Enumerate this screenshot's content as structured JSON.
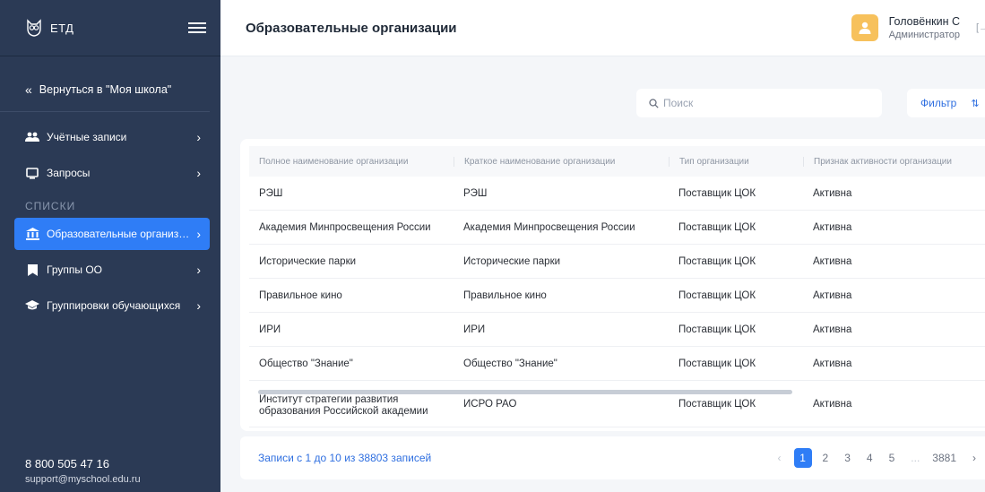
{
  "app": {
    "logo_text": "ЕТД"
  },
  "sidebar": {
    "back_label": "Вернуться в \"Моя школа\"",
    "items": [
      {
        "label": "Учётные записи",
        "icon": "users-icon"
      },
      {
        "label": "Запросы",
        "icon": "monitor-icon"
      }
    ],
    "section_label": "СПИСКИ",
    "list_items": [
      {
        "label": "Образовательные организа...",
        "icon": "bank-icon",
        "active": true
      },
      {
        "label": "Группы ОО",
        "icon": "bookmark-icon"
      },
      {
        "label": "Группировки обучающихся",
        "icon": "graduation-cap-icon"
      }
    ],
    "phone": "8 800 505 47 16",
    "email": "support@myschool.edu.ru"
  },
  "header": {
    "title": "Образовательные организации",
    "user_name": "Головёнкин С",
    "user_role": "Администратор",
    "logout_label": "[→"
  },
  "toolbar": {
    "search_placeholder": "Поиск",
    "filter_label": "Фильтр"
  },
  "table": {
    "columns": [
      "Полное наименование организации",
      "Краткое наименование организации",
      "Тип организации",
      "Признак активности организации"
    ],
    "rows": [
      [
        "РЭШ",
        "РЭШ",
        "Поставщик ЦОК",
        "Активна"
      ],
      [
        "Академия Минпросвещения России",
        "Академия Минпросвещения России",
        "Поставщик ЦОК",
        "Активна"
      ],
      [
        "Исторические парки",
        "Исторические парки",
        "Поставщик ЦОК",
        "Активна"
      ],
      [
        "Правильное кино",
        "Правильное кино",
        "Поставщик ЦОК",
        "Активна"
      ],
      [
        "ИРИ",
        "ИРИ",
        "Поставщик ЦОК",
        "Активна"
      ],
      [
        "Общество \"Знание\"",
        "Общество \"Знание\"",
        "Поставщик ЦОК",
        "Активна"
      ],
      [
        "Институт стратегии развития образования Российской академии",
        "ИСРО РАО",
        "Поставщик ЦОК",
        "Активна"
      ]
    ]
  },
  "pagination": {
    "records_text": "Записи с 1 до 10 из 38803 записей",
    "prev": "‹",
    "pages": [
      "1",
      "2",
      "3",
      "4",
      "5"
    ],
    "dots": "...",
    "last": "3881",
    "next": "›"
  },
  "colors": {
    "sidebar": "#2b3a55",
    "accent": "#2f7df6",
    "avatar": "#f7c15c"
  }
}
